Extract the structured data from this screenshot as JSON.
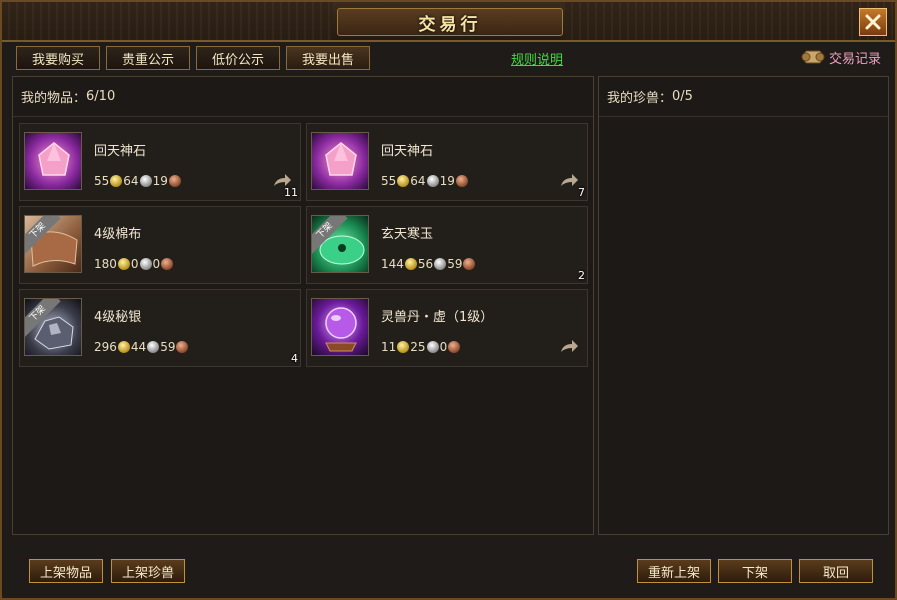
{
  "window": {
    "title": "交易行"
  },
  "tabs": [
    {
      "label": "我要购买"
    },
    {
      "label": "贵重公示"
    },
    {
      "label": "低价公示"
    },
    {
      "label": "我要出售"
    }
  ],
  "rules_link": "规则说明",
  "trade_record": "交易记录",
  "left_panel": {
    "label": "我的物品：",
    "count": "6/10"
  },
  "right_panel": {
    "label": "我的珍兽：",
    "count": "0/5"
  },
  "items": [
    {
      "name": "回天神石",
      "qty": "11",
      "gold": "55",
      "silver": "64",
      "copper": "19",
      "icon": "pink-gem-icon",
      "off_shelf": false,
      "has_arrow": true
    },
    {
      "name": "回天神石",
      "qty": "7",
      "gold": "55",
      "silver": "64",
      "copper": "19",
      "icon": "pink-gem-icon",
      "off_shelf": false,
      "has_arrow": true
    },
    {
      "name": "4级棉布",
      "qty": "",
      "gold": "180",
      "silver": "0",
      "copper": "0",
      "icon": "cloth-icon",
      "off_shelf": true,
      "off_label": "下架",
      "has_arrow": false
    },
    {
      "name": "玄天寒玉",
      "qty": "2",
      "gold": "144",
      "silver": "56",
      "copper": "59",
      "icon": "jade-icon",
      "off_shelf": true,
      "off_label": "下架",
      "has_arrow": false
    },
    {
      "name": "4级秘银",
      "qty": "4",
      "gold": "296",
      "silver": "44",
      "copper": "59",
      "icon": "ore-icon",
      "off_shelf": true,
      "off_label": "下架",
      "has_arrow": false
    },
    {
      "name": "灵兽丹・虚（1级）",
      "qty": "",
      "gold": "11",
      "silver": "25",
      "copper": "0",
      "icon": "crystal-ball-icon",
      "off_shelf": false,
      "has_arrow": true
    }
  ],
  "buttons": {
    "list_item": "上架物品",
    "list_pet": "上架珍兽",
    "relist": "重新上架",
    "unlist": "下架",
    "cancel": "取回"
  }
}
